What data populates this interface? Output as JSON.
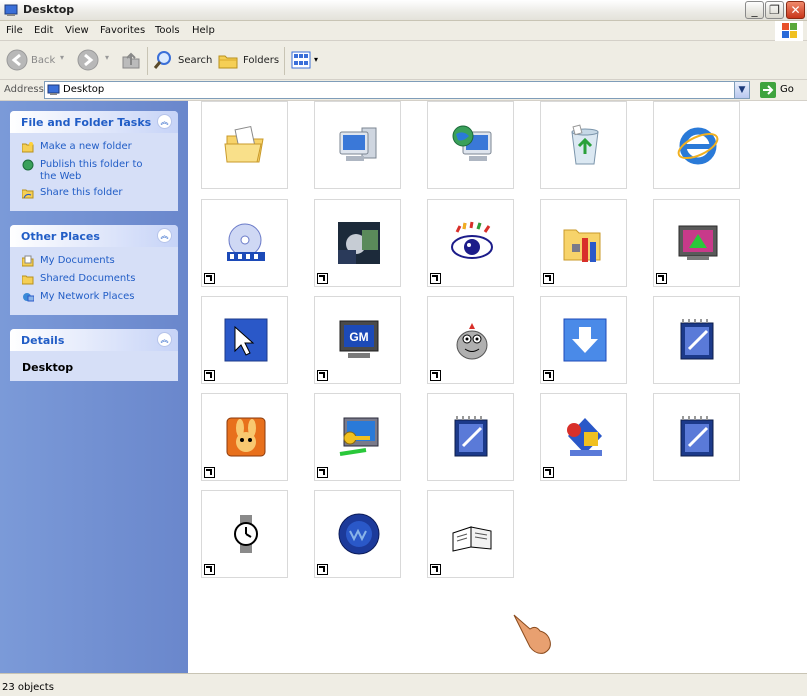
{
  "window": {
    "title": "Desktop"
  },
  "menu": [
    "File",
    "Edit",
    "View",
    "Favorites",
    "Tools",
    "Help"
  ],
  "toolbar": {
    "back_label": "Back",
    "search_label": "Search",
    "folders_label": "Folders"
  },
  "address": {
    "label": "Address",
    "value": "Desktop",
    "go_label": "Go"
  },
  "tasks_panel": {
    "title": "File and Folder Tasks",
    "items": [
      "Make a new folder",
      "Publish this folder to the Web",
      "Share this folder"
    ]
  },
  "places_panel": {
    "title": "Other Places",
    "items": [
      "My Documents",
      "Shared Documents",
      "My Network Places"
    ]
  },
  "details_panel": {
    "title": "Details",
    "name": "Desktop"
  },
  "icons": [
    {
      "name": "my-documents-icon",
      "shortcut": false
    },
    {
      "name": "my-computer-icon",
      "shortcut": false
    },
    {
      "name": "my-network-places-icon",
      "shortcut": false
    },
    {
      "name": "recycle-bin-icon",
      "shortcut": false
    },
    {
      "name": "internet-explorer-icon",
      "shortcut": false
    },
    {
      "name": "media-disc-icon",
      "shortcut": true
    },
    {
      "name": "image-viewer-icon",
      "shortcut": true
    },
    {
      "name": "eye-icon",
      "shortcut": true
    },
    {
      "name": "folder-tools-icon",
      "shortcut": true
    },
    {
      "name": "monitor-upload-icon",
      "shortcut": true
    },
    {
      "name": "cursor-tool-icon",
      "shortcut": true
    },
    {
      "name": "gm-monitor-icon",
      "shortcut": true
    },
    {
      "name": "mascot-icon",
      "shortcut": true
    },
    {
      "name": "download-arrow-icon",
      "shortcut": true
    },
    {
      "name": "notepad-icon",
      "shortcut": false
    },
    {
      "name": "rabbit-icon",
      "shortcut": true
    },
    {
      "name": "computer-key-icon",
      "shortcut": true
    },
    {
      "name": "notepad-icon",
      "shortcut": false
    },
    {
      "name": "shapes-icon",
      "shortcut": true
    },
    {
      "name": "notepad-icon",
      "shortcut": false
    },
    {
      "name": "wristwatch-icon",
      "shortcut": true
    },
    {
      "name": "blue-seal-icon",
      "shortcut": true
    },
    {
      "name": "open-book-icon",
      "shortcut": true
    }
  ],
  "status": {
    "text": "23 objects"
  }
}
